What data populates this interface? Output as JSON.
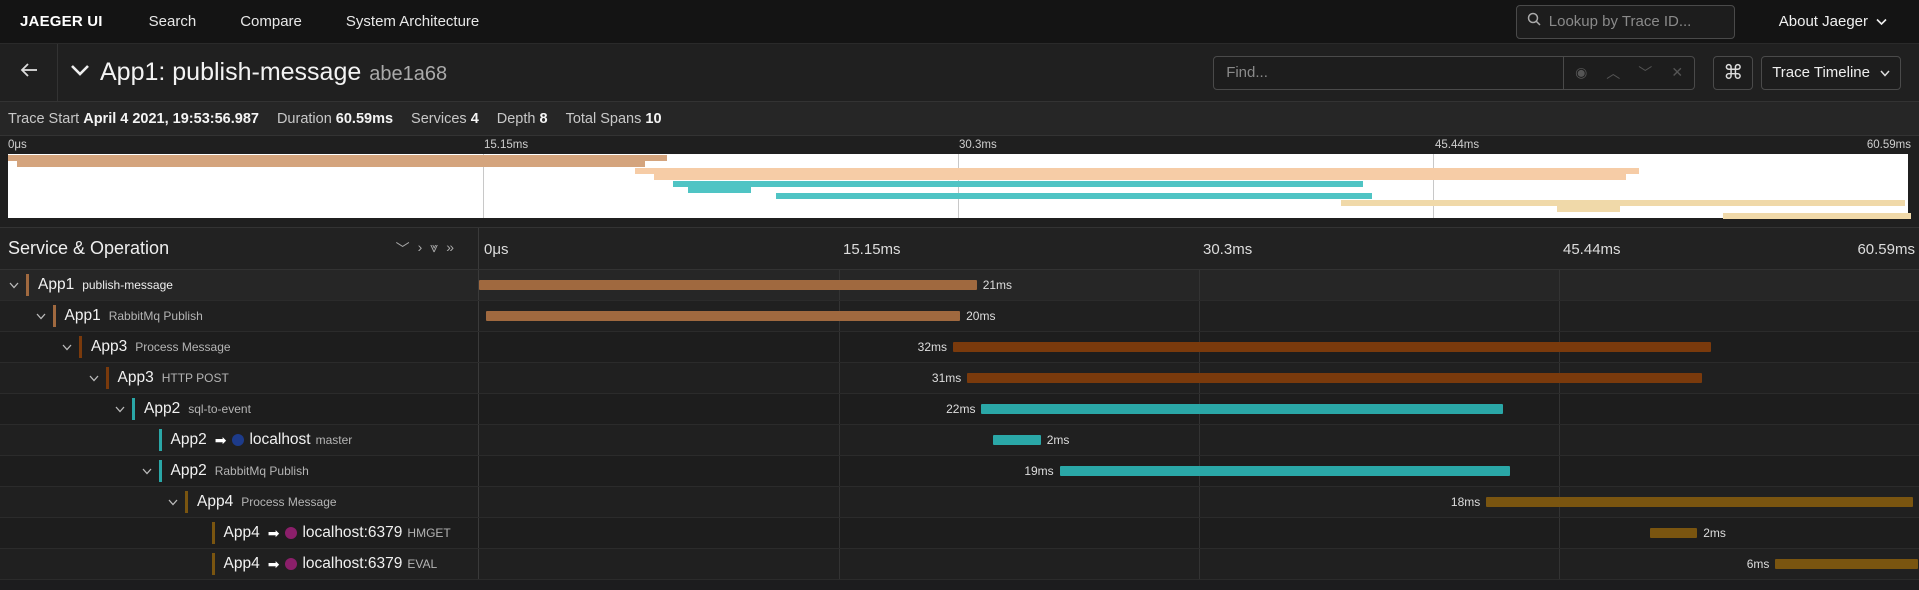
{
  "nav": {
    "brand": "JAEGER UI",
    "links": [
      "Search",
      "Compare",
      "System Architecture"
    ],
    "lookup_placeholder": "Lookup by Trace ID...",
    "about": "About Jaeger"
  },
  "trace": {
    "service": "App1",
    "name": "App1: publish-message",
    "id": "abe1a68",
    "find_placeholder": "Find...",
    "view_mode": "Trace Timeline"
  },
  "summary": {
    "start_label": "Trace Start",
    "start_value": "April 4 2021, 19:53:56.987",
    "duration_label": "Duration",
    "duration_value": "60.59ms",
    "services_label": "Services",
    "services_value": "4",
    "depth_label": "Depth",
    "depth_value": "8",
    "spans_label": "Total Spans",
    "spans_value": "10"
  },
  "ticks": [
    "0μs",
    "15.15ms",
    "30.3ms",
    "45.44ms",
    "60.59ms"
  ],
  "total_ms": 60.59,
  "detail_header": "Service & Operation",
  "colors": {
    "app1": "#a0693f",
    "app3": "#7a3a0c",
    "app2": "#2aa7a7",
    "app4": "#7a5510"
  },
  "minimap_colors": {
    "app1": "#d4a47d",
    "app3": "#f6cca6",
    "app2": "#4fc4c4",
    "app4": "#f0d9a9"
  },
  "spans": [
    {
      "depth": 0,
      "toggle": "v",
      "service": "App1",
      "operation": "publish-message",
      "color": "app1",
      "start_ms": 0.0,
      "duration_ms": 21,
      "label": "21ms"
    },
    {
      "depth": 1,
      "toggle": "v",
      "service": "App1",
      "operation": "RabbitMq Publish",
      "color": "app1",
      "start_ms": 0.3,
      "duration_ms": 20,
      "label": "20ms"
    },
    {
      "depth": 2,
      "toggle": "v",
      "service": "App3",
      "operation": "Process Message",
      "color": "app3",
      "start_ms": 20.0,
      "duration_ms": 32,
      "label": "32ms"
    },
    {
      "depth": 3,
      "toggle": "v",
      "service": "App3",
      "operation": "HTTP POST",
      "color": "app3",
      "start_ms": 20.6,
      "duration_ms": 31,
      "label": "31ms"
    },
    {
      "depth": 4,
      "toggle": "v",
      "service": "App2",
      "operation": "sql-to-event",
      "color": "app2",
      "start_ms": 21.2,
      "duration_ms": 22,
      "label": "22ms"
    },
    {
      "depth": 5,
      "toggle": "",
      "service": "App2",
      "peer": "localhost",
      "peer_color": "#1d3b8a",
      "operation": "master",
      "color": "app2",
      "start_ms": 21.7,
      "duration_ms": 2,
      "label": "2ms"
    },
    {
      "depth": 5,
      "toggle": "v",
      "service": "App2",
      "operation": "RabbitMq Publish",
      "color": "app2",
      "start_ms": 24.5,
      "duration_ms": 19,
      "label": "19ms"
    },
    {
      "depth": 6,
      "toggle": "v",
      "service": "App4",
      "operation": "Process Message",
      "color": "app4",
      "start_ms": 42.5,
      "duration_ms": 18,
      "label": "18ms"
    },
    {
      "depth": 7,
      "toggle": "",
      "service": "App4",
      "peer": "localhost:6379",
      "peer_color": "#8b1f6a",
      "operation": "HMGET",
      "color": "app4",
      "start_ms": 49.4,
      "duration_ms": 2,
      "label": "2ms"
    },
    {
      "depth": 7,
      "toggle": "",
      "service": "App4",
      "peer": "localhost:6379",
      "peer_color": "#8b1f6a",
      "operation": "EVAL",
      "color": "app4",
      "start_ms": 54.7,
      "duration_ms": 6,
      "label": "6ms"
    }
  ]
}
